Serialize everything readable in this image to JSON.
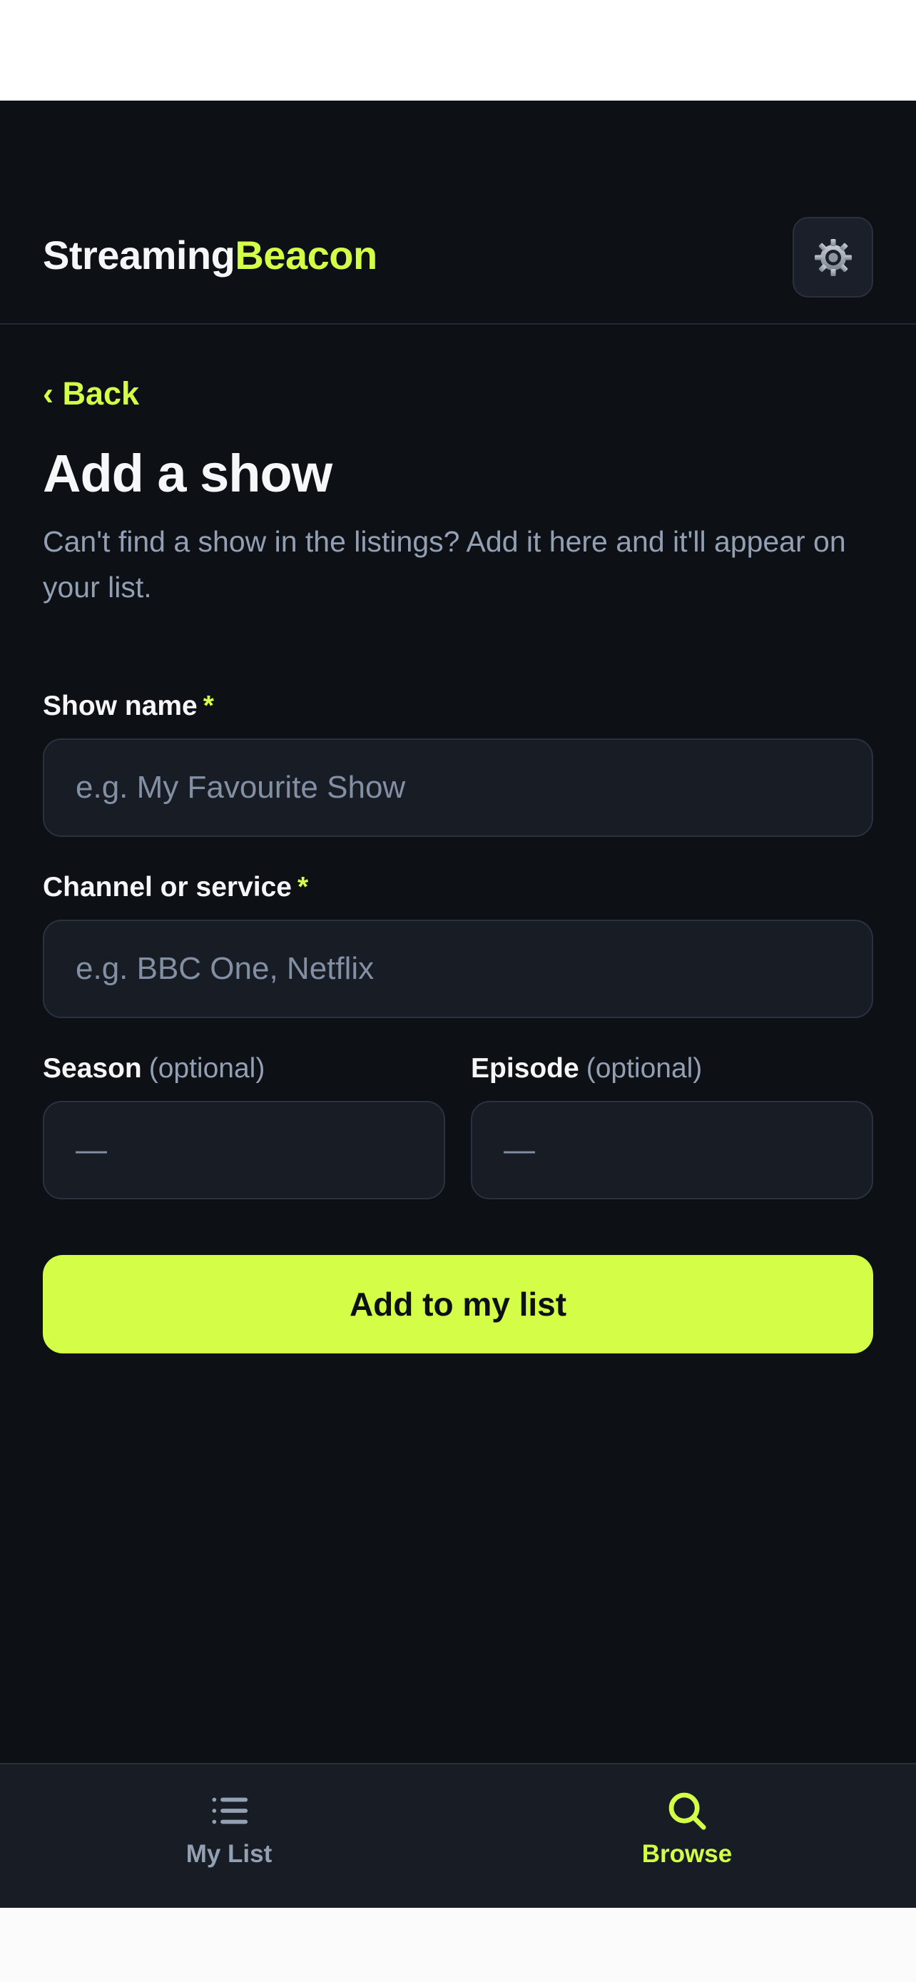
{
  "header": {
    "brand_part1": "Streaming",
    "brand_part2": "Beacon",
    "settings_icon": "gear-icon"
  },
  "nav": {
    "back_label": "‹ Back"
  },
  "page": {
    "title": "Add a show",
    "subtitle": "Can't find a show in the listings? Add it here and it'll appear on your list."
  },
  "form": {
    "show_name": {
      "label": "Show name",
      "required_mark": "*",
      "value": "",
      "placeholder": "e.g. My Favourite Show"
    },
    "channel": {
      "label": "Channel or service",
      "required_mark": "*",
      "value": "",
      "placeholder": "e.g. BBC One, Netflix"
    },
    "season": {
      "label": "Season",
      "optional_label": "(optional)",
      "value": "",
      "placeholder": "—"
    },
    "episode": {
      "label": "Episode",
      "optional_label": "(optional)",
      "value": "",
      "placeholder": "—"
    },
    "submit_label": "Add to my list"
  },
  "tabbar": {
    "items": [
      {
        "label": "My List",
        "icon": "list-icon",
        "active": false
      },
      {
        "label": "Browse",
        "icon": "search-icon",
        "active": true
      }
    ]
  },
  "colors": {
    "background": "#0d1015",
    "accent": "#d4ff47",
    "muted_text": "#93a0b4",
    "field_bg": "#171c25"
  }
}
